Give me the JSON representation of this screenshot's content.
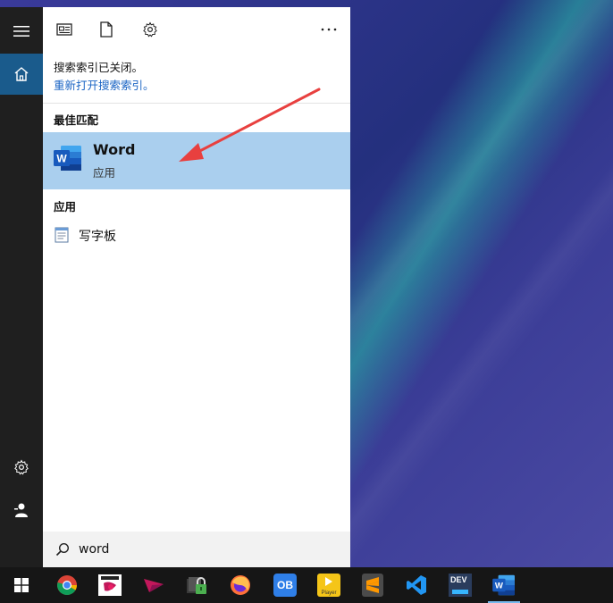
{
  "search_panel": {
    "notice_line1": "搜索索引已关闭。",
    "notice_link": "重新打开搜索索引。",
    "best_match_label": "最佳匹配",
    "best_match": {
      "title": "Word",
      "subtitle": "应用"
    },
    "apps_label": "应用",
    "apps": [
      {
        "name": "写字板",
        "icon": "wordpad-icon"
      }
    ],
    "search_query": "word"
  },
  "toolbar": {
    "icons": [
      "document-view-icon",
      "file-icon",
      "gear-icon",
      "more-options-icon"
    ]
  },
  "sidebar": {
    "icons": [
      "hamburger-menu-icon",
      "home-icon",
      "gear-icon",
      "user-icon"
    ]
  },
  "taskbar": {
    "apps": [
      "windows-start-icon",
      "chrome-icon",
      "xmind-icon",
      "feishu-icon",
      "lock-app-icon",
      "firefox-icon",
      "ob-app-icon",
      "player-icon",
      "sublime-icon",
      "vscode-icon",
      "devecostudio-icon",
      "word-icon"
    ],
    "tile_text": {
      "ob": "OB",
      "player": "Player",
      "dev": "DEV"
    }
  },
  "colors": {
    "accent": "#1a5b8c",
    "selection": "#aacfee",
    "link": "#1a64c4",
    "word_blue": "#185abd",
    "arrow": "#e8403f"
  }
}
